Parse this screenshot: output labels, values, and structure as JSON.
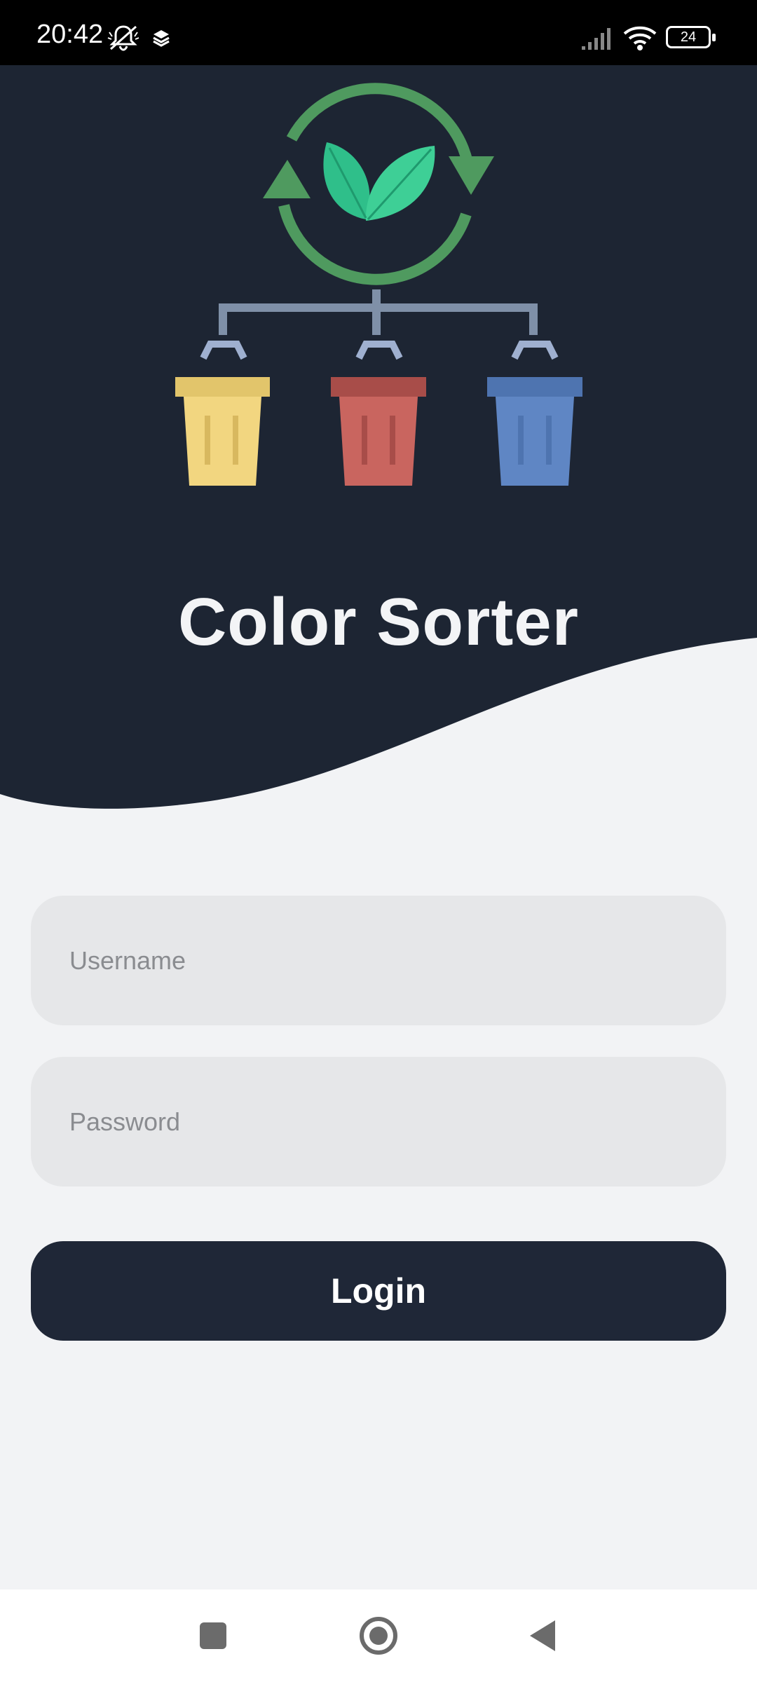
{
  "status_bar": {
    "time": "20:42",
    "battery": "24",
    "icons": [
      "mute-icon",
      "layers-icon",
      "signal-icon",
      "wifi-icon",
      "battery-icon"
    ]
  },
  "app": {
    "title": "Color Sorter",
    "colors": {
      "dark_bg": "#1d2533",
      "light_bg": "#f2f3f5",
      "recycle_green": "#4f9a5f",
      "leaf_green": "#2fbf8a",
      "bin_yellow": "#f2d680",
      "bin_red": "#c9655f",
      "bin_blue": "#5f86c4",
      "connector": "#7f90a8"
    }
  },
  "form": {
    "username_placeholder": "Username",
    "password_placeholder": "Password",
    "login_label": "Login"
  },
  "nav": {
    "buttons": [
      "recent-apps-icon",
      "home-icon",
      "back-icon"
    ]
  }
}
